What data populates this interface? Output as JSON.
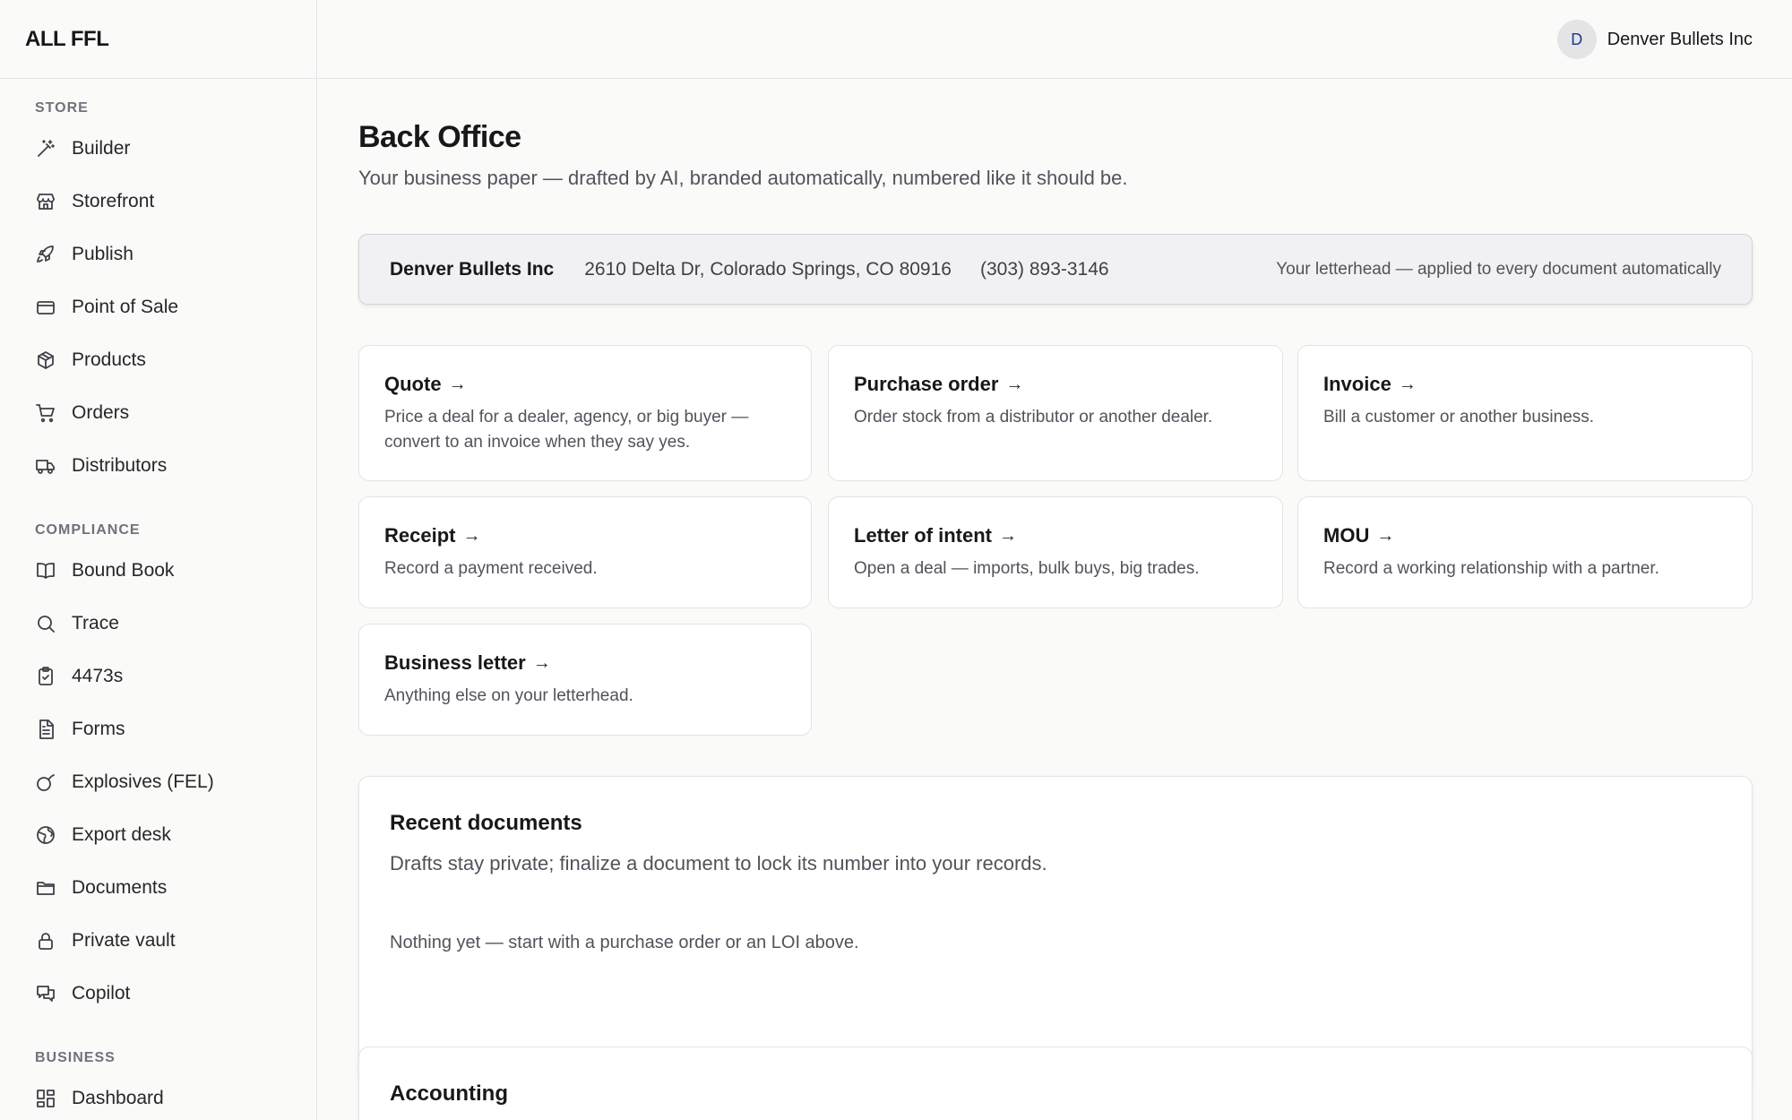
{
  "brand": "ALL FFL",
  "user": {
    "initial": "D",
    "name": "Denver Bullets Inc"
  },
  "sidebar": {
    "store_label": "STORE",
    "store_items": [
      {
        "label": "Builder",
        "icon": "magic-wand-icon"
      },
      {
        "label": "Storefront",
        "icon": "storefront-icon"
      },
      {
        "label": "Publish",
        "icon": "rocket-icon"
      },
      {
        "label": "Point of Sale",
        "icon": "credit-card-icon"
      },
      {
        "label": "Products",
        "icon": "package-icon"
      },
      {
        "label": "Orders",
        "icon": "cart-icon"
      },
      {
        "label": "Distributors",
        "icon": "truck-icon"
      }
    ],
    "compliance_label": "COMPLIANCE",
    "compliance_items": [
      {
        "label": "Bound Book",
        "icon": "book-icon"
      },
      {
        "label": "Trace",
        "icon": "search-icon"
      },
      {
        "label": "4473s",
        "icon": "clipboard-check-icon"
      },
      {
        "label": "Forms",
        "icon": "file-text-icon"
      },
      {
        "label": "Explosives (FEL)",
        "icon": "bomb-icon"
      },
      {
        "label": "Export desk",
        "icon": "globe-icon"
      },
      {
        "label": "Documents",
        "icon": "folder-icon"
      },
      {
        "label": "Private vault",
        "icon": "lock-icon"
      },
      {
        "label": "Copilot",
        "icon": "chat-icon"
      }
    ],
    "business_label": "BUSINESS",
    "business_items": [
      {
        "label": "Dashboard",
        "icon": "dashboard-icon"
      }
    ]
  },
  "main": {
    "title": "Back Office",
    "subtitle": "Your business paper — drafted by AI, branded automatically, numbered like it should be.",
    "letterhead": {
      "name": "Denver Bullets Inc",
      "address": "2610 Delta Dr, Colorado Springs, CO 80916",
      "phone": "(303) 893-3146",
      "note": "Your letterhead — applied to every document automatically"
    },
    "doc_types": [
      {
        "title": "Quote",
        "desc": "Price a deal for a dealer, agency, or big buyer — convert to an invoice when they say yes."
      },
      {
        "title": "Purchase order",
        "desc": "Order stock from a distributor or another dealer."
      },
      {
        "title": "Invoice",
        "desc": "Bill a customer or another business."
      },
      {
        "title": "Receipt",
        "desc": "Record a payment received."
      },
      {
        "title": "Letter of intent",
        "desc": "Open a deal — imports, bulk buys, big trades."
      },
      {
        "title": "MOU",
        "desc": "Record a working relationship with a partner."
      },
      {
        "title": "Business letter",
        "desc": "Anything else on your letterhead."
      }
    ],
    "arrow": "→",
    "recent": {
      "title": "Recent documents",
      "subtitle": "Drafts stay private; finalize a document to lock its number into your records.",
      "empty": "Nothing yet — start with a purchase order or an LOI above."
    },
    "accounting": {
      "title": "Accounting"
    }
  }
}
